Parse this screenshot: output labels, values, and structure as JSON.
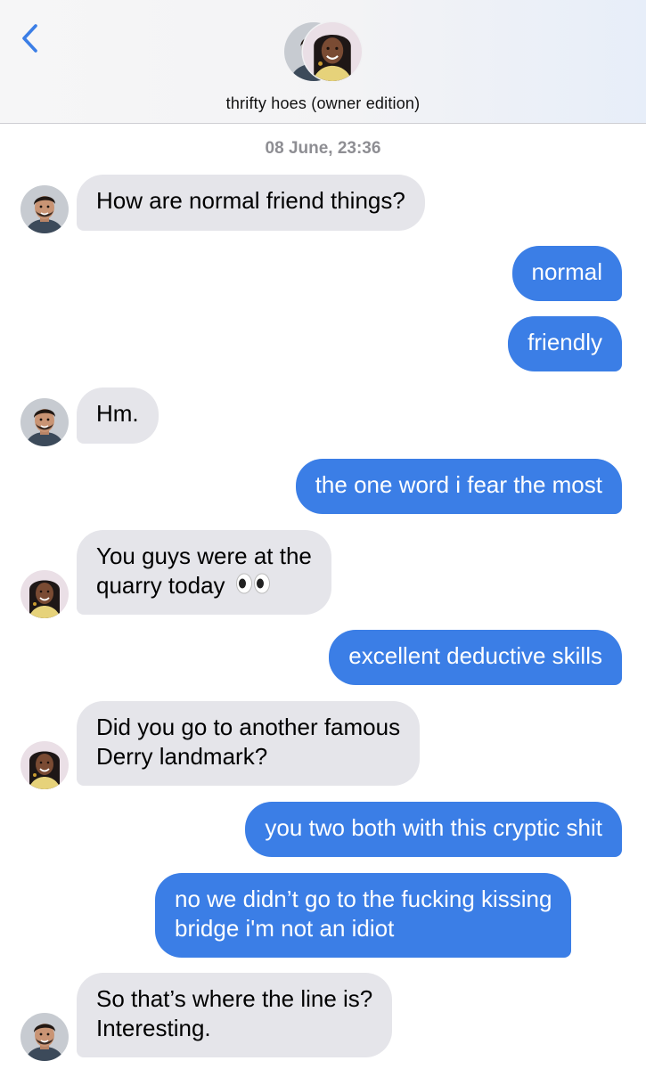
{
  "header": {
    "title": "thrifty hoes (owner edition)",
    "back_icon": "chevron-left-icon",
    "accent_color": "#3b7ee6"
  },
  "timestamp": "08 June, 23:36",
  "messages": [
    {
      "direction": "incoming",
      "sender_avatar": "man-avatar",
      "lines": [
        "How are normal friend things?"
      ]
    },
    {
      "direction": "outgoing",
      "lines": [
        "normal"
      ]
    },
    {
      "direction": "outgoing",
      "lines": [
        "friendly"
      ]
    },
    {
      "direction": "incoming",
      "sender_avatar": "man-avatar",
      "lines": [
        "Hm."
      ]
    },
    {
      "direction": "outgoing",
      "lines": [
        "the one word i fear the most"
      ]
    },
    {
      "direction": "incoming",
      "sender_avatar": "woman-avatar",
      "lines": [
        "You guys were at the",
        "quarry today"
      ],
      "emoji": "eyes-emoji"
    },
    {
      "direction": "outgoing",
      "lines": [
        "excellent deductive skills"
      ]
    },
    {
      "direction": "incoming",
      "sender_avatar": "woman-avatar",
      "lines": [
        "Did you go to another famous",
        "Derry landmark?"
      ]
    },
    {
      "direction": "outgoing",
      "lines": [
        "you two both with this cryptic shit"
      ]
    },
    {
      "direction": "outgoing",
      "lines": [
        "no we didn’t go to the fucking kissing",
        "bridge i'm not an idiot"
      ]
    },
    {
      "direction": "incoming",
      "sender_avatar": "man-avatar",
      "lines": [
        "So that’s where the line is?",
        "Interesting."
      ]
    }
  ]
}
